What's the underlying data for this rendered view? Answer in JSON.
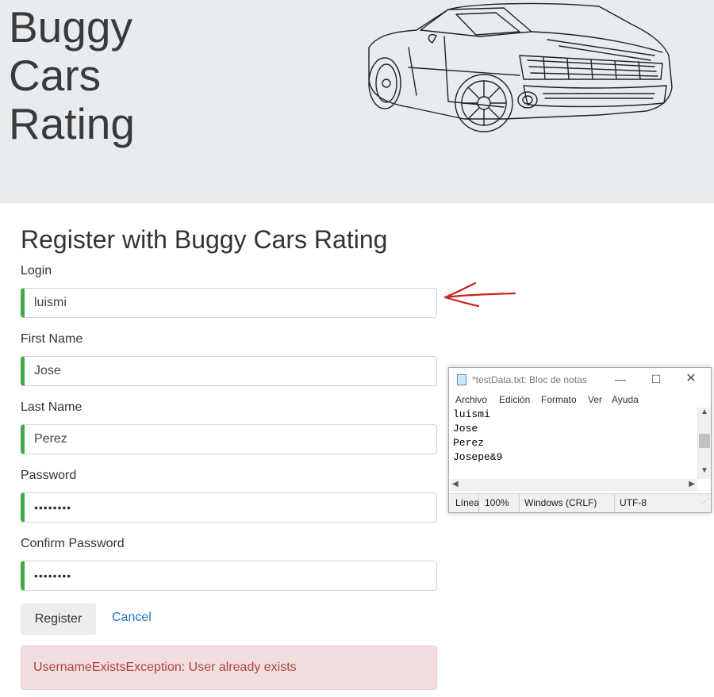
{
  "header": {
    "brand_lines": [
      "Buggy",
      "Cars",
      "Rating"
    ]
  },
  "form": {
    "title": "Register with Buggy Cars Rating",
    "fields": [
      {
        "label": "Login",
        "value": "luismi"
      },
      {
        "label": "First Name",
        "value": "Jose"
      },
      {
        "label": "Last Name",
        "value": "Perez"
      },
      {
        "label": "Password",
        "value": "••••••••"
      },
      {
        "label": "Confirm Password",
        "value": "••••••••"
      }
    ],
    "register_label": "Register",
    "cancel_label": "Cancel",
    "error_message": "UsernameExistsException: User already exists"
  },
  "notepad": {
    "title": "*testData.txt: Bloc de notas",
    "controls": {
      "minimize": "—",
      "maximize": "☐",
      "close": "✕"
    },
    "menu": [
      "Archivo",
      "Edición",
      "Formato",
      "Ver",
      "Ayuda"
    ],
    "lines": [
      "luismi",
      "Jose",
      "Perez",
      "Josepe&9"
    ],
    "status": {
      "line": "Línea",
      "zoom": "100%",
      "line_ending": "Windows (CRLF)",
      "encoding": "UTF-8"
    }
  },
  "colors": {
    "valid_border": "#42a948",
    "link": "#1a73c9",
    "error_bg": "#f2dede",
    "error_text": "#a94442",
    "annotation_arrow": "#d02020"
  }
}
